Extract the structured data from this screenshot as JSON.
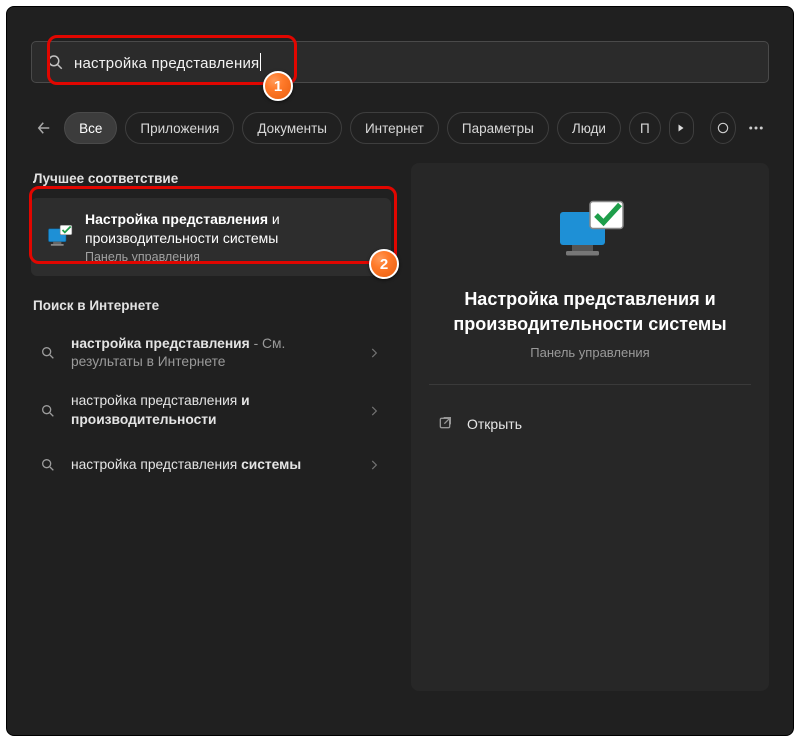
{
  "search": {
    "query": "настройка представления"
  },
  "steps": {
    "one": "1",
    "two": "2"
  },
  "tabs": {
    "all": "Все",
    "apps": "Приложения",
    "documents": "Документы",
    "internet": "Интернет",
    "settings": "Параметры",
    "people": "Люди",
    "more_letter": "П"
  },
  "sections": {
    "best": "Лучшее соответствие",
    "web": "Поиск в Интернете"
  },
  "best_match": {
    "title_bold": "Настройка представления",
    "title_tail": " и производительности системы",
    "subtitle": "Панель управления"
  },
  "web_results": [
    {
      "bold": "настройка представления",
      "tail": " - См. результаты в Интернете",
      "tail_sub": true
    },
    {
      "pre": "настройка представления ",
      "bold": "и производительности"
    },
    {
      "pre": "настройка представления ",
      "bold": "системы"
    }
  ],
  "preview": {
    "title": "Настройка представления и производительности системы",
    "subtitle": "Панель управления",
    "open": "Открыть"
  }
}
